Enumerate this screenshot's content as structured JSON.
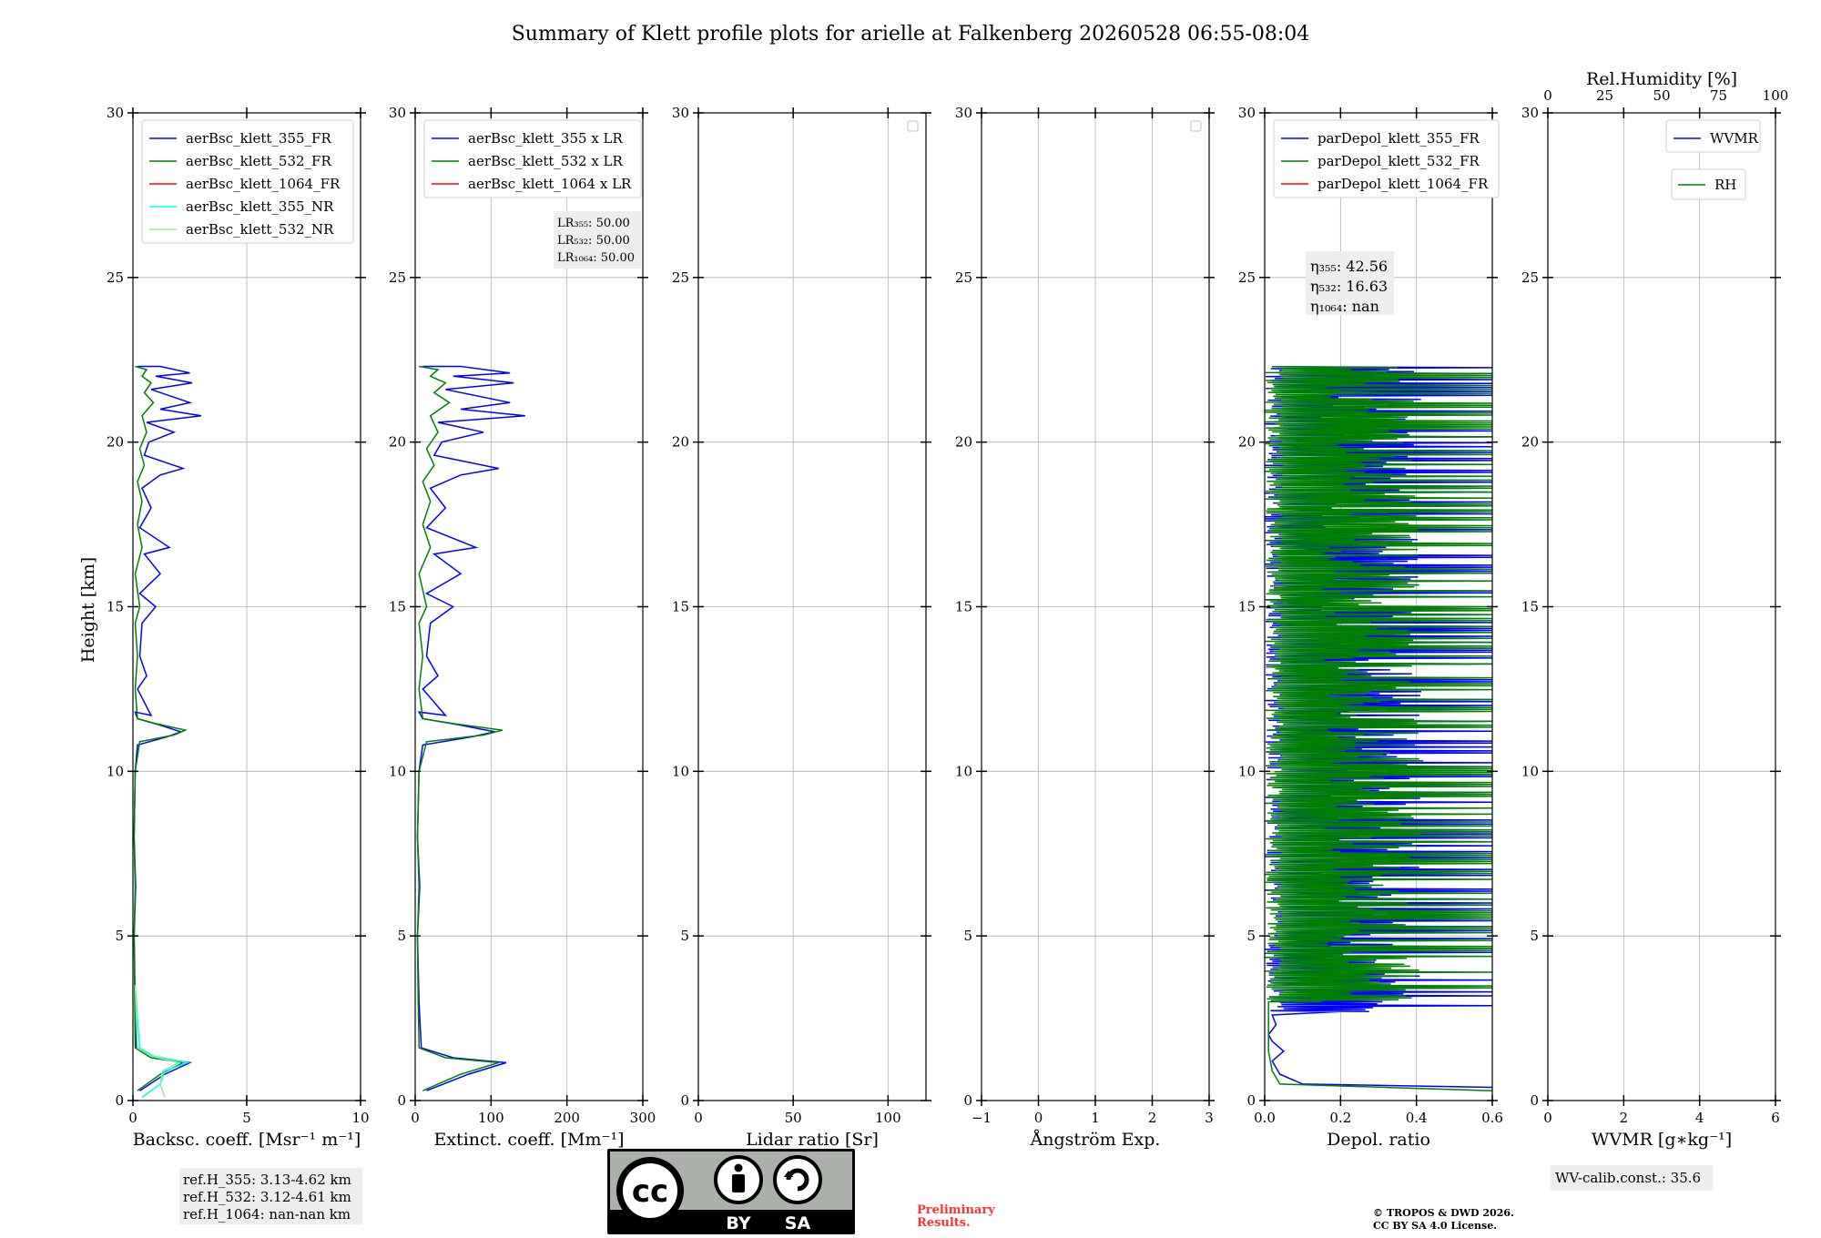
{
  "title": "Summary of Klett profile plots for arielle at Falkenberg 20260528 06:55-08:04",
  "ylabel": "Height [km]",
  "colors": {
    "c355": "#0000ff",
    "c532": "#008000",
    "c1064": "#ff0000",
    "c355nr": "#00ffff",
    "c532nr": "#90ee90",
    "preliminary": "#ff3333"
  },
  "chart_data": [
    {
      "id": "bsc",
      "type": "line",
      "xlabel": "Backsc. coeff. [Msr⁻¹ m⁻¹]",
      "xlim": [
        0,
        10
      ],
      "xticks": [
        0,
        5,
        10
      ],
      "ylim": [
        0,
        30
      ],
      "yticks": [
        0,
        5,
        10,
        15,
        20,
        25,
        30
      ],
      "legend": [
        "aerBsc_klett_355_FR",
        "aerBsc_klett_532_FR",
        "aerBsc_klett_1064_FR",
        "aerBsc_klett_355_NR",
        "aerBsc_klett_532_NR"
      ],
      "legend_colors": [
        "#0000ff",
        "#008000",
        "#ff0000",
        "#00ffff",
        "#90ee90"
      ],
      "note": [
        "ref.H_355: 3.13-4.62 km",
        "ref.H_532: 3.12-4.61 km",
        "ref.H_1064: nan-nan km"
      ],
      "series": [
        {
          "name": "aerBsc_klett_355_FR",
          "color": "#0000ff",
          "points": [
            [
              0.3,
              0.3
            ],
            [
              1.4,
              0.8
            ],
            [
              2.5,
              1.15
            ],
            [
              1.0,
              1.3
            ],
            [
              0.15,
              1.6
            ],
            [
              0.1,
              3
            ],
            [
              0.05,
              5
            ],
            [
              0.12,
              6.5
            ],
            [
              0.05,
              8
            ],
            [
              0.1,
              10
            ],
            [
              0.2,
              10.8
            ],
            [
              1.5,
              11.05
            ],
            [
              2.1,
              11.2
            ],
            [
              1.2,
              11.4
            ],
            [
              0.2,
              11.6
            ],
            [
              0.1,
              11.8
            ],
            [
              0.8,
              11.7
            ],
            [
              0.2,
              12.5
            ],
            [
              0.6,
              12.9
            ],
            [
              0.3,
              13.5
            ],
            [
              0.4,
              14.5
            ],
            [
              1.0,
              15.0
            ],
            [
              0.3,
              15.4
            ],
            [
              1.2,
              16.0
            ],
            [
              0.5,
              16.6
            ],
            [
              1.6,
              16.8
            ],
            [
              0.3,
              17.4
            ],
            [
              0.8,
              18.0
            ],
            [
              0.4,
              18.6
            ],
            [
              1.2,
              19.0
            ],
            [
              2.2,
              19.2
            ],
            [
              0.5,
              19.6
            ],
            [
              0.7,
              20.0
            ],
            [
              1.8,
              20.3
            ],
            [
              0.6,
              20.6
            ],
            [
              3.0,
              20.8
            ],
            [
              1.2,
              21.0
            ],
            [
              2.5,
              21.2
            ],
            [
              0.8,
              21.6
            ],
            [
              2.6,
              21.8
            ],
            [
              1.0,
              22.0
            ],
            [
              2.5,
              22.1
            ],
            [
              1.2,
              22.3
            ],
            [
              0.2,
              22.3
            ]
          ]
        },
        {
          "name": "aerBsc_klett_532_FR",
          "color": "#008000",
          "points": [
            [
              0.2,
              0.3
            ],
            [
              1.2,
              0.8
            ],
            [
              2.2,
              1.15
            ],
            [
              0.8,
              1.3
            ],
            [
              0.1,
              1.6
            ],
            [
              0.08,
              3
            ],
            [
              0.05,
              5
            ],
            [
              0.1,
              6.5
            ],
            [
              0.05,
              8
            ],
            [
              0.1,
              10
            ],
            [
              0.3,
              10.9
            ],
            [
              1.8,
              11.1
            ],
            [
              2.3,
              11.25
            ],
            [
              1.0,
              11.45
            ],
            [
              0.2,
              11.6
            ],
            [
              0.1,
              12.5
            ],
            [
              0.2,
              13.5
            ],
            [
              0.1,
              14.5
            ],
            [
              0.3,
              15.0
            ],
            [
              0.1,
              16.0
            ],
            [
              0.4,
              16.8
            ],
            [
              0.2,
              17.5
            ],
            [
              0.4,
              18.2
            ],
            [
              0.2,
              18.8
            ],
            [
              0.5,
              19.3
            ],
            [
              0.3,
              19.8
            ],
            [
              0.6,
              20.3
            ],
            [
              0.4,
              20.8
            ],
            [
              0.9,
              21.2
            ],
            [
              0.5,
              21.5
            ],
            [
              0.8,
              21.8
            ],
            [
              0.4,
              22.0
            ],
            [
              0.6,
              22.2
            ],
            [
              0.1,
              22.3
            ]
          ]
        },
        {
          "name": "aerBsc_klett_355_NR",
          "color": "#00ffff",
          "points": [
            [
              0.4,
              0.1
            ],
            [
              1.2,
              0.5
            ],
            [
              1.4,
              0.9
            ],
            [
              2.4,
              1.15
            ],
            [
              0.9,
              1.35
            ],
            [
              0.3,
              1.6
            ],
            [
              0.2,
              2.5
            ],
            [
              0.1,
              3.5
            ]
          ]
        },
        {
          "name": "aerBsc_klett_532_NR",
          "color": "#90ee90",
          "points": [
            [
              1.4,
              0.1
            ],
            [
              1.2,
              0.5
            ],
            [
              1.3,
              0.9
            ],
            [
              2.0,
              1.15
            ],
            [
              0.8,
              1.35
            ],
            [
              0.2,
              1.6
            ],
            [
              0.15,
              2.5
            ],
            [
              0.1,
              3.5
            ]
          ]
        }
      ]
    },
    {
      "id": "ext",
      "type": "line",
      "xlabel": "Extinct. coeff. [Mm⁻¹]",
      "xlim": [
        0,
        300
      ],
      "xticks": [
        0,
        100,
        200,
        300
      ],
      "ylim": [
        0,
        30
      ],
      "yticks": [
        0,
        5,
        10,
        15,
        20,
        25,
        30
      ],
      "legend": [
        "aerBsc_klett_355 x LR",
        "aerBsc_klett_532 x LR",
        "aerBsc_klett_1064 x LR"
      ],
      "legend_colors": [
        "#0000ff",
        "#008000",
        "#ff0000"
      ],
      "note": [
        "LR₃₅₅: 50.00",
        "LR₅₃₂: 50.00",
        "LR₁₀₆₄: 50.00"
      ],
      "series": [
        {
          "name": "aerBsc_klett_355 x LR",
          "color": "#0000ff",
          "points": [
            [
              15,
              0.3
            ],
            [
              70,
              0.8
            ],
            [
              120,
              1.15
            ],
            [
              50,
              1.3
            ],
            [
              8,
              1.6
            ],
            [
              5,
              3
            ],
            [
              3,
              5
            ],
            [
              6,
              6.5
            ],
            [
              3,
              8
            ],
            [
              5,
              10
            ],
            [
              10,
              10.8
            ],
            [
              75,
              11.05
            ],
            [
              105,
              11.2
            ],
            [
              60,
              11.4
            ],
            [
              10,
              11.6
            ],
            [
              5,
              11.8
            ],
            [
              40,
              11.7
            ],
            [
              10,
              12.5
            ],
            [
              30,
              12.9
            ],
            [
              15,
              13.5
            ],
            [
              20,
              14.5
            ],
            [
              50,
              15.0
            ],
            [
              15,
              15.4
            ],
            [
              60,
              16.0
            ],
            [
              25,
              16.6
            ],
            [
              80,
              16.8
            ],
            [
              15,
              17.4
            ],
            [
              40,
              18.0
            ],
            [
              20,
              18.6
            ],
            [
              60,
              19.0
            ],
            [
              110,
              19.2
            ],
            [
              25,
              19.6
            ],
            [
              35,
              20.0
            ],
            [
              90,
              20.3
            ],
            [
              30,
              20.6
            ],
            [
              145,
              20.8
            ],
            [
              60,
              21.0
            ],
            [
              125,
              21.2
            ],
            [
              40,
              21.6
            ],
            [
              130,
              21.8
            ],
            [
              50,
              22.0
            ],
            [
              125,
              22.1
            ],
            [
              60,
              22.3
            ],
            [
              10,
              22.3
            ]
          ]
        },
        {
          "name": "aerBsc_klett_532 x LR",
          "color": "#008000",
          "points": [
            [
              10,
              0.3
            ],
            [
              60,
              0.8
            ],
            [
              110,
              1.15
            ],
            [
              40,
              1.3
            ],
            [
              5,
              1.6
            ],
            [
              4,
              3
            ],
            [
              3,
              5
            ],
            [
              5,
              6.5
            ],
            [
              3,
              8
            ],
            [
              5,
              10
            ],
            [
              15,
              10.9
            ],
            [
              90,
              11.1
            ],
            [
              115,
              11.25
            ],
            [
              50,
              11.45
            ],
            [
              10,
              11.6
            ],
            [
              5,
              12.5
            ],
            [
              10,
              13.5
            ],
            [
              5,
              14.5
            ],
            [
              15,
              15.0
            ],
            [
              5,
              16.0
            ],
            [
              20,
              16.8
            ],
            [
              10,
              17.5
            ],
            [
              20,
              18.2
            ],
            [
              10,
              18.8
            ],
            [
              25,
              19.3
            ],
            [
              15,
              19.8
            ],
            [
              30,
              20.3
            ],
            [
              20,
              20.8
            ],
            [
              45,
              21.2
            ],
            [
              25,
              21.5
            ],
            [
              40,
              21.8
            ],
            [
              20,
              22.0
            ],
            [
              30,
              22.2
            ],
            [
              5,
              22.3
            ]
          ]
        }
      ]
    },
    {
      "id": "lr",
      "type": "line",
      "xlabel": "Lidar ratio [Sr]",
      "xlim": [
        0,
        120
      ],
      "xticks": [
        0,
        50,
        100
      ],
      "ylim": [
        0,
        30
      ],
      "yticks": [
        0,
        5,
        10,
        15,
        20,
        25,
        30
      ],
      "legend": [],
      "legend_colors": [],
      "note": [],
      "series": []
    },
    {
      "id": "ang",
      "type": "line",
      "xlabel": "Ångström Exp.",
      "xlim": [
        -1,
        3
      ],
      "xticks": [
        -1,
        0,
        1,
        2,
        3
      ],
      "ylim": [
        0,
        30
      ],
      "yticks": [
        0,
        5,
        10,
        15,
        20,
        25,
        30
      ],
      "legend": [],
      "legend_colors": [],
      "note": [],
      "series": []
    },
    {
      "id": "dep",
      "type": "line",
      "xlabel": "Depol. ratio",
      "xlim": [
        0,
        0.6
      ],
      "xticks": [
        0.0,
        0.2,
        0.4,
        0.6
      ],
      "ylim": [
        0,
        30
      ],
      "yticks": [
        0,
        5,
        10,
        15,
        20,
        25,
        30
      ],
      "legend": [
        "parDepol_klett_355_FR",
        "parDepol_klett_532_FR",
        "parDepol_klett_1064_FR"
      ],
      "legend_colors": [
        "#0000ff",
        "#008000",
        "#ff0000"
      ],
      "note": [
        "η₃₅₅: 42.56",
        "η₅₃₂: 16.63",
        "η₁₀₆₄: nan"
      ],
      "series": [
        {
          "name": "parDepol_klett_355_FR",
          "color": "#0000ff",
          "noisy": [
            2.7,
            22.3,
            0.6
          ],
          "points": [
            [
              0.6,
              0.4
            ],
            [
              0.1,
              0.5
            ],
            [
              0.04,
              0.8
            ],
            [
              0.02,
              1.2
            ],
            [
              0.05,
              1.5
            ],
            [
              0.02,
              1.8
            ],
            [
              0.01,
              2.0
            ],
            [
              0.03,
              2.3
            ],
            [
              0.02,
              2.6
            ],
            [
              0.2,
              2.7
            ]
          ]
        },
        {
          "name": "parDepol_klett_532_FR",
          "color": "#008000",
          "noisy": [
            3.0,
            22.3,
            0.6
          ],
          "points": [
            [
              0.6,
              0.3
            ],
            [
              0.04,
              0.5
            ],
            [
              0.02,
              0.9
            ],
            [
              0.01,
              1.5
            ],
            [
              0.01,
              3.0
            ]
          ]
        }
      ]
    },
    {
      "id": "wv",
      "type": "line",
      "xlabel": "WVMR [g∗kg⁻¹]",
      "xlim": [
        0,
        6
      ],
      "xticks": [
        0,
        2,
        4,
        6
      ],
      "ylim": [
        0,
        30
      ],
      "yticks": [
        0,
        5,
        10,
        15,
        20,
        25,
        30
      ],
      "top_xlabel": "Rel.Humidity [%]",
      "top_xlim": [
        0,
        100
      ],
      "top_xticks": [
        0,
        25,
        50,
        75,
        100
      ],
      "legend": [
        "WVMR"
      ],
      "legend_colors": [
        "#0000ff"
      ],
      "legend2": [
        "RH"
      ],
      "legend2_colors": [
        "#008000"
      ],
      "note": [
        "WV-calib.const.: 35.6"
      ],
      "series": []
    }
  ],
  "footer": {
    "preliminary": "Preliminary Results.",
    "copyright_line1": "© TROPOS & DWD 2026.",
    "copyright_line2": "CC BY SA 4.0 License.",
    "cc_by": "BY",
    "cc_sa": "SA"
  }
}
